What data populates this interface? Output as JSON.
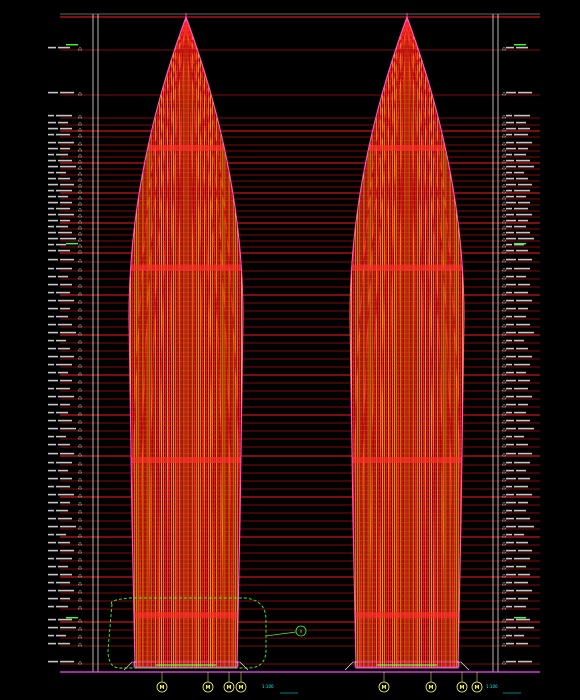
{
  "drawing": {
    "background": "#000000",
    "colors": {
      "level_line": "#ff1a1a",
      "tower_outline": "#ff2020",
      "tower_fill": "#8b0000",
      "mullion": "#ffff00",
      "frame": "#ffffff",
      "label": "#e8e8e8",
      "label_alt": "#33ff33",
      "bubble": "#ffff66",
      "callout": "#33ff33",
      "dimension": "#00ffff"
    },
    "towers": [
      {
        "name": "tower-left"
      },
      {
        "name": "tower-right"
      }
    ],
    "detail_callout": {
      "tag": "A"
    },
    "grid_bubbles": [
      {
        "tag": "M"
      },
      {
        "tag": "M"
      },
      {
        "tag": "M"
      },
      {
        "tag": "M"
      },
      {
        "tag": "M"
      },
      {
        "tag": "M"
      },
      {
        "tag": "M"
      },
      {
        "tag": "M"
      }
    ],
    "dimension_text": [
      "1:100",
      "1:100"
    ]
  }
}
